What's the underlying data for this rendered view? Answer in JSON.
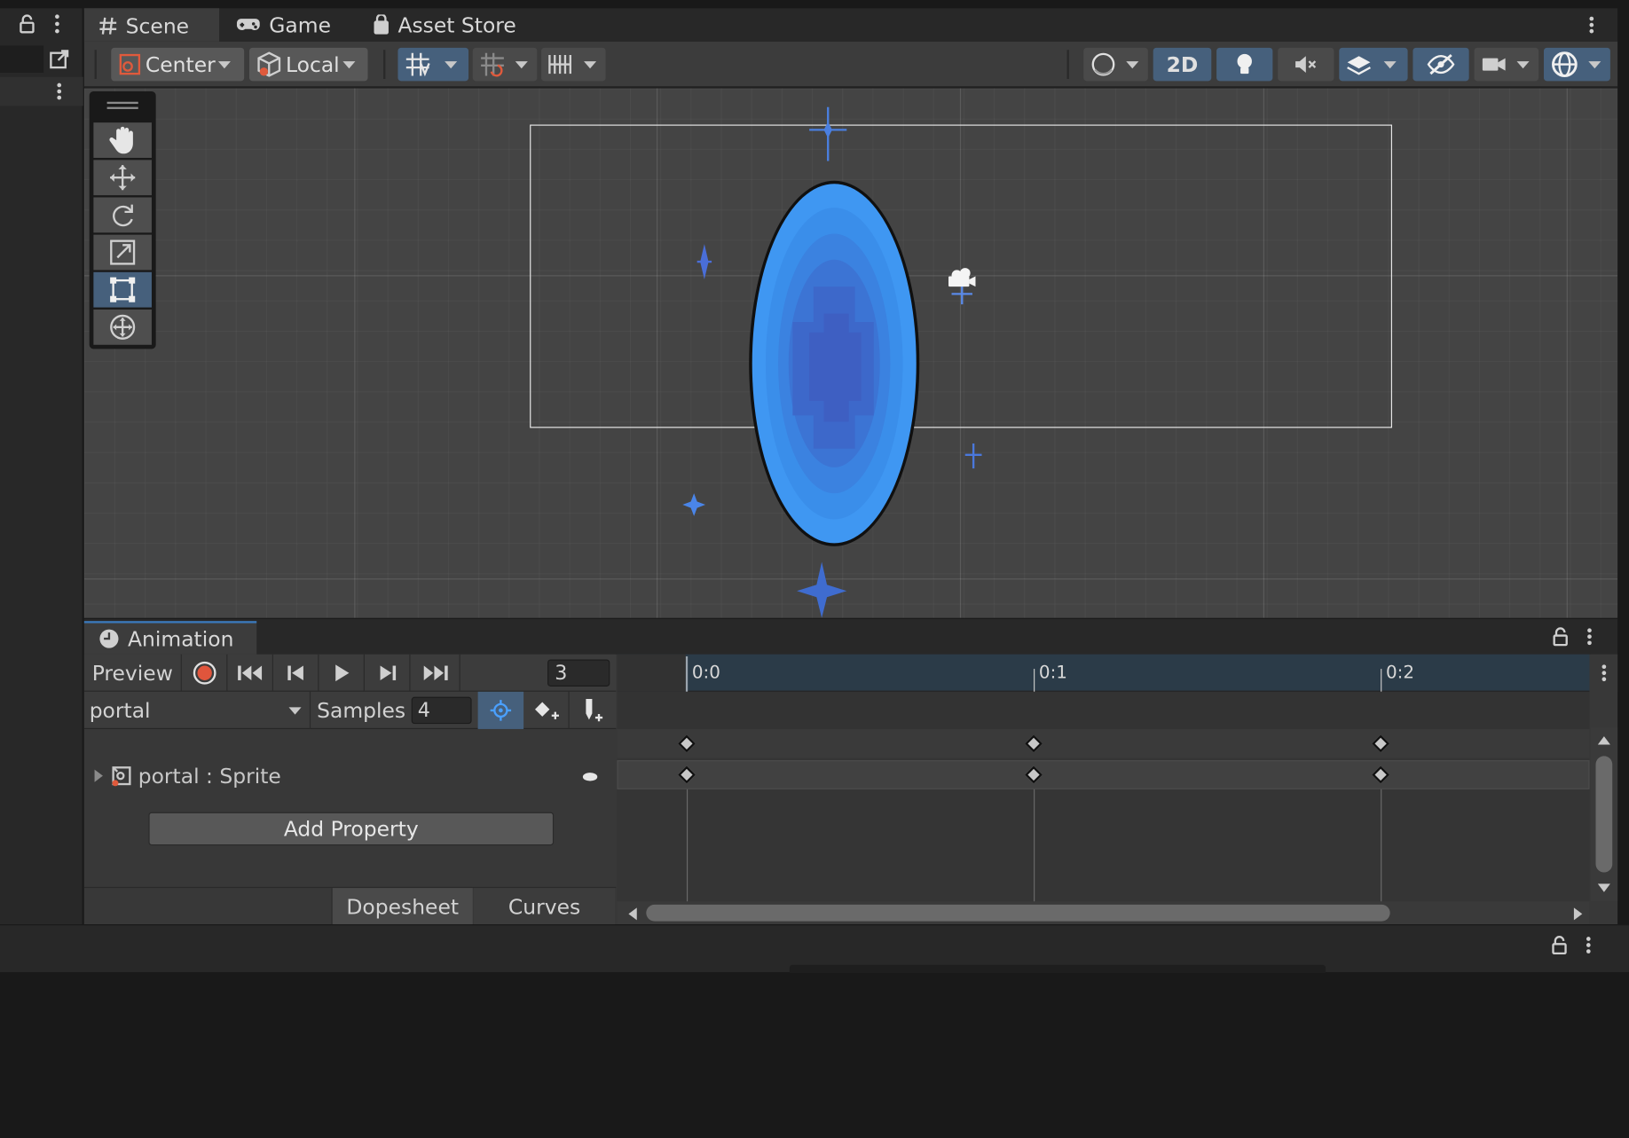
{
  "scene_tabs": [
    {
      "label": "Scene",
      "icon": "hash-icon",
      "active": true
    },
    {
      "label": "Game",
      "icon": "gamepad-icon",
      "active": false
    },
    {
      "label": "Asset Store",
      "icon": "shopping-bag-icon",
      "active": false
    }
  ],
  "toolbar": {
    "pivot_label": "Center",
    "space_label": "Local",
    "mode_2d_label": "2D"
  },
  "tools": [
    "hand-tool",
    "move-tool",
    "rotate-tool",
    "scale-tool",
    "rect-tool",
    "transform-tool"
  ],
  "active_tool": "rect-tool",
  "animation": {
    "tab_label": "Animation",
    "preview_label": "Preview",
    "frame_value": "3",
    "clip_name": "portal",
    "samples_label": "Samples",
    "samples_value": "4",
    "property_label": "portal : Sprite",
    "add_property_label": "Add Property",
    "dopesheet_label": "Dopesheet",
    "curves_label": "Curves",
    "timeline_ticks": [
      "0:0",
      "0:1",
      "0:2"
    ]
  },
  "colors": {
    "accent_blue": "#46607c",
    "record_red": "#e0553c",
    "portal_outer": "#3f97f2",
    "portal_inner": "#3e5fc2",
    "timeline_bg": "#2b3b48"
  }
}
